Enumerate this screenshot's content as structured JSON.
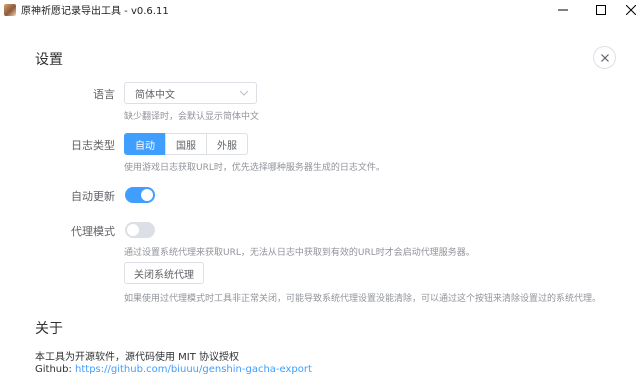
{
  "window": {
    "title": "原神祈愿记录导出工具 - v0.6.11",
    "icons": {
      "app": "app-icon",
      "minimize": "minimize-icon",
      "maximize": "maximize-icon",
      "close": "close-icon"
    }
  },
  "settings": {
    "title": "设置",
    "close_icon": "close-icon",
    "language": {
      "label": "语言",
      "selected": "简体中文",
      "hint": "缺少翻译时，会默认显示简体中文"
    },
    "log_type": {
      "label": "日志类型",
      "options": [
        "自动",
        "国服",
        "外服"
      ],
      "selected": "自动",
      "hint": "使用游戏日志获取URL时，优先选择哪种服务器生成的日志文件。"
    },
    "auto_update": {
      "label": "自动更新",
      "enabled": true
    },
    "proxy_mode": {
      "label": "代理模式",
      "enabled": false,
      "hint": "通过设置系统代理来获取URL，无法从日志中获取到有效的URL时才会启动代理服务器。",
      "button": "关闭系统代理",
      "note": "如果使用过代理模式时工具非正常关闭，可能导致系统代理设置没能清除，可以通过这个按钮来清除设置过的系统代理。"
    }
  },
  "about": {
    "title": "关于",
    "line1": "本工具为开源软件，源代码使用 MIT 协议授权",
    "github_label": "Github: ",
    "github_link": "https://github.com/biuuu/genshin-gacha-export"
  },
  "colors": {
    "accent": "#409eff",
    "border": "#dcdfe6",
    "hint": "#909399",
    "text": "#303133"
  }
}
